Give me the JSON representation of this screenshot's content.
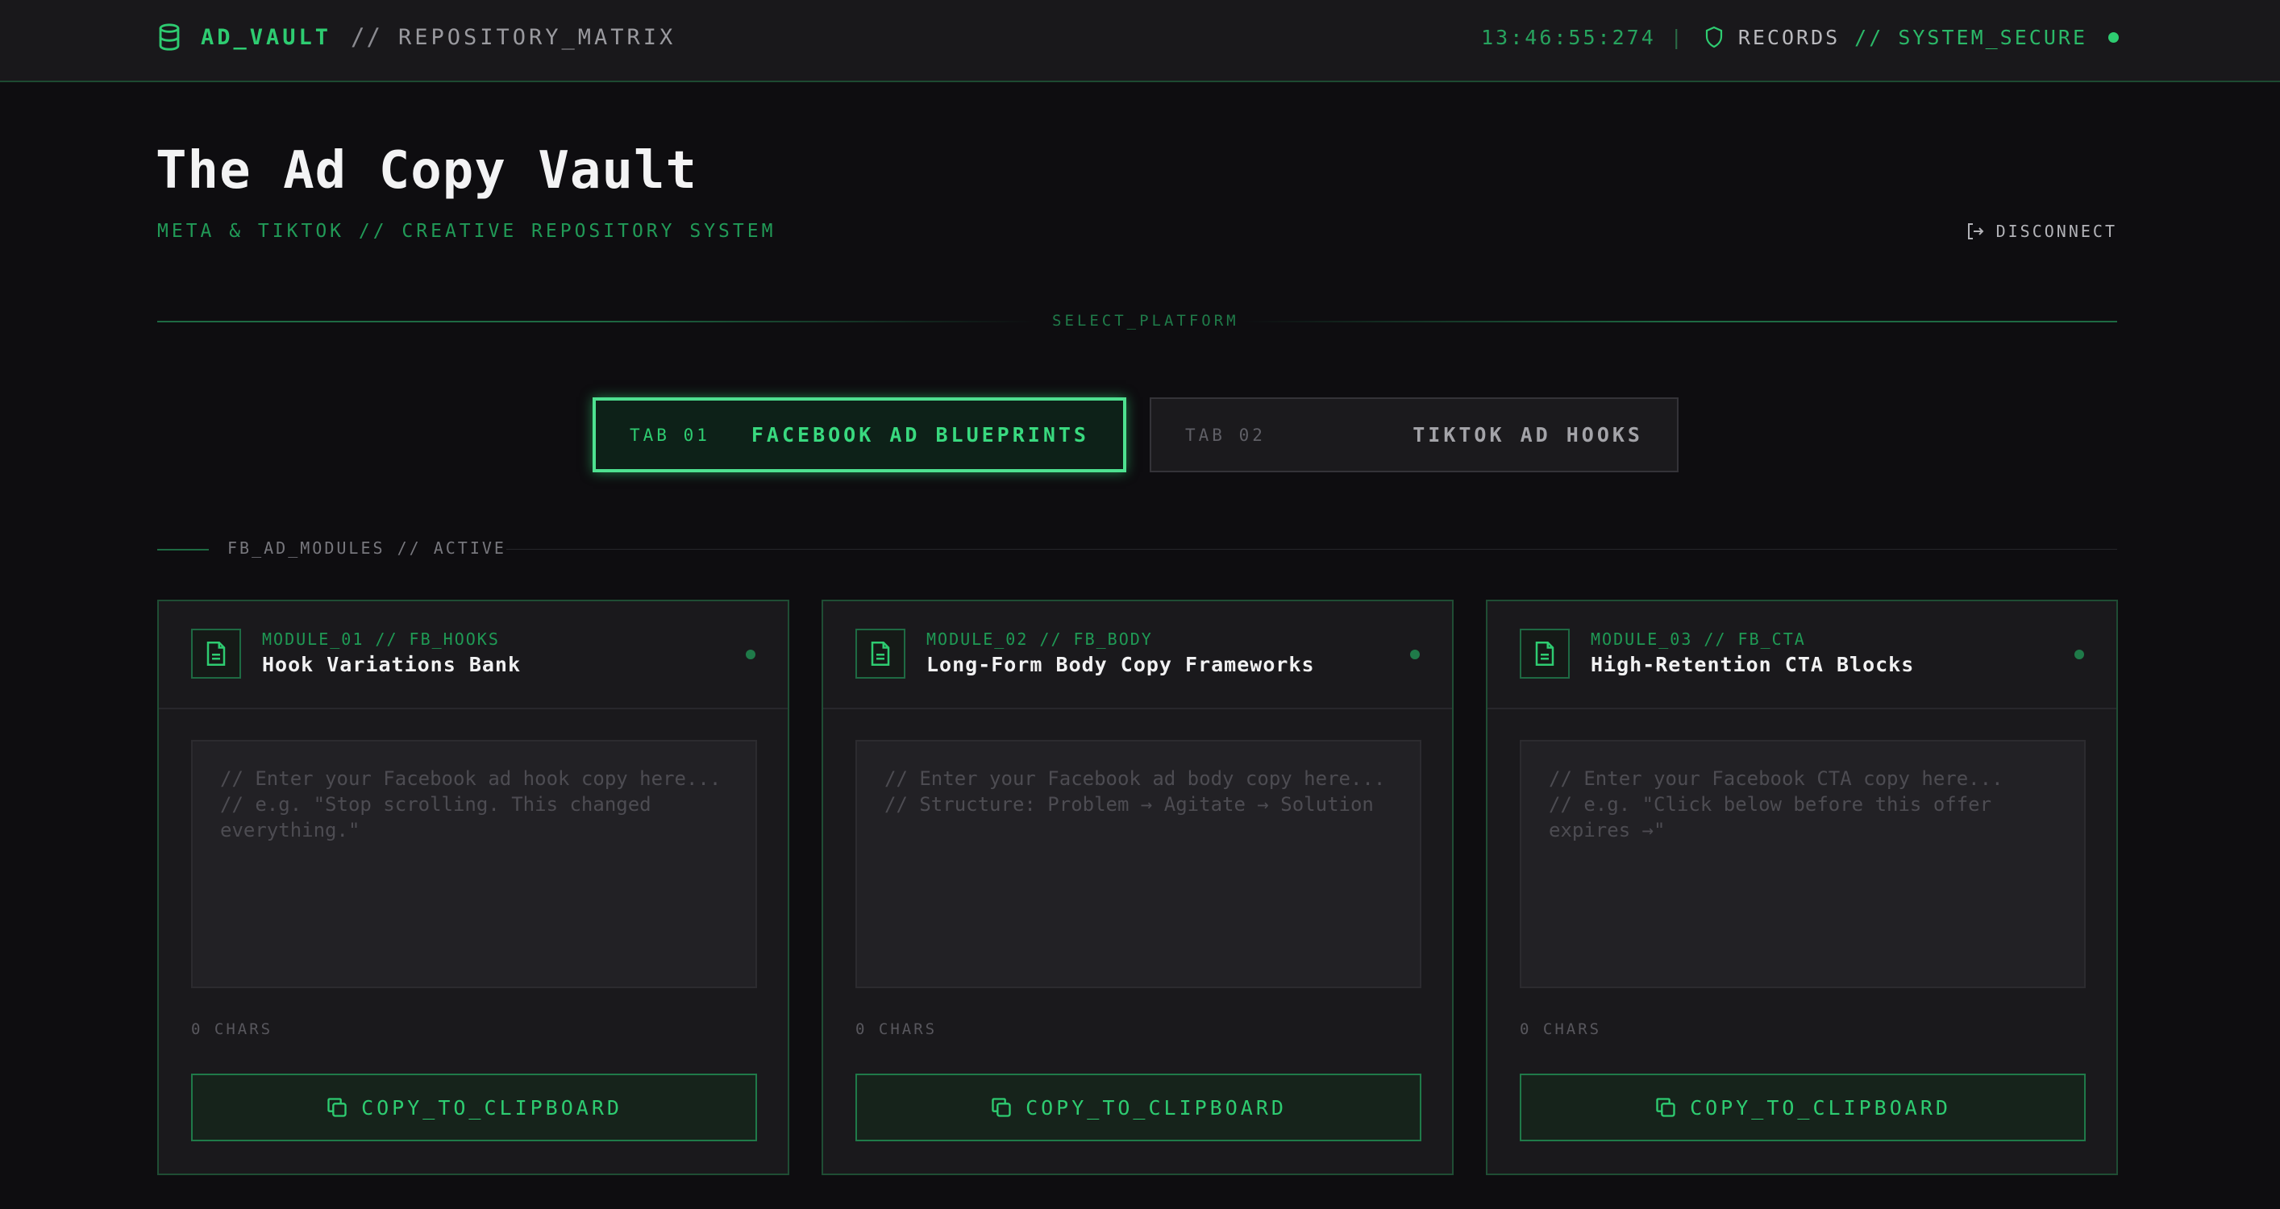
{
  "colors": {
    "accent": "#2ecc71",
    "background": "#0e0d10",
    "panel": "#1a191c",
    "border": "#1f4d34"
  },
  "topbar": {
    "app_name": "AD_VAULT",
    "separator": "//",
    "section": "REPOSITORY_MATRIX",
    "clock": "13:46:55:274",
    "pipe": "|",
    "records_label": "RECORDS",
    "system_status": "// SYSTEM_SECURE",
    "icons": [
      "database-icon",
      "shield-icon",
      "status-dot"
    ]
  },
  "header": {
    "title": "The Ad Copy Vault",
    "subtitle": "META & TIKTOK // CREATIVE REPOSITORY SYSTEM",
    "disconnect_label": "DISCONNECT",
    "disconnect_icon": "logout-icon"
  },
  "platform_select": {
    "label": "SELECT_PLATFORM",
    "tabs": [
      {
        "number": "TAB 01",
        "label": "FACEBOOK AD BLUEPRINTS",
        "active": true
      },
      {
        "number": "TAB 02",
        "label": "TIKTOK AD HOOKS",
        "active": false
      }
    ]
  },
  "section": {
    "label": "FB_AD_MODULES // ACTIVE"
  },
  "modules": [
    {
      "code": "MODULE_01 // FB_HOOKS",
      "title": "Hook Variations Bank",
      "placeholder": "// Enter your Facebook ad hook copy here...\n// e.g. \"Stop scrolling. This changed everything.\"",
      "value": "",
      "chars": "0 CHARS",
      "copy_label": "COPY_TO_CLIPBOARD"
    },
    {
      "code": "MODULE_02 // FB_BODY",
      "title": "Long-Form Body Copy Frameworks",
      "placeholder": "// Enter your Facebook ad body copy here...\n// Structure: Problem → Agitate → Solution",
      "value": "",
      "chars": "0 CHARS",
      "copy_label": "COPY_TO_CLIPBOARD"
    },
    {
      "code": "MODULE_03 // FB_CTA",
      "title": "High-Retention CTA Blocks",
      "placeholder": "// Enter your Facebook CTA copy here...\n// e.g. \"Click below before this offer expires →\"",
      "value": "",
      "chars": "0 CHARS",
      "copy_label": "COPY_TO_CLIPBOARD"
    }
  ]
}
